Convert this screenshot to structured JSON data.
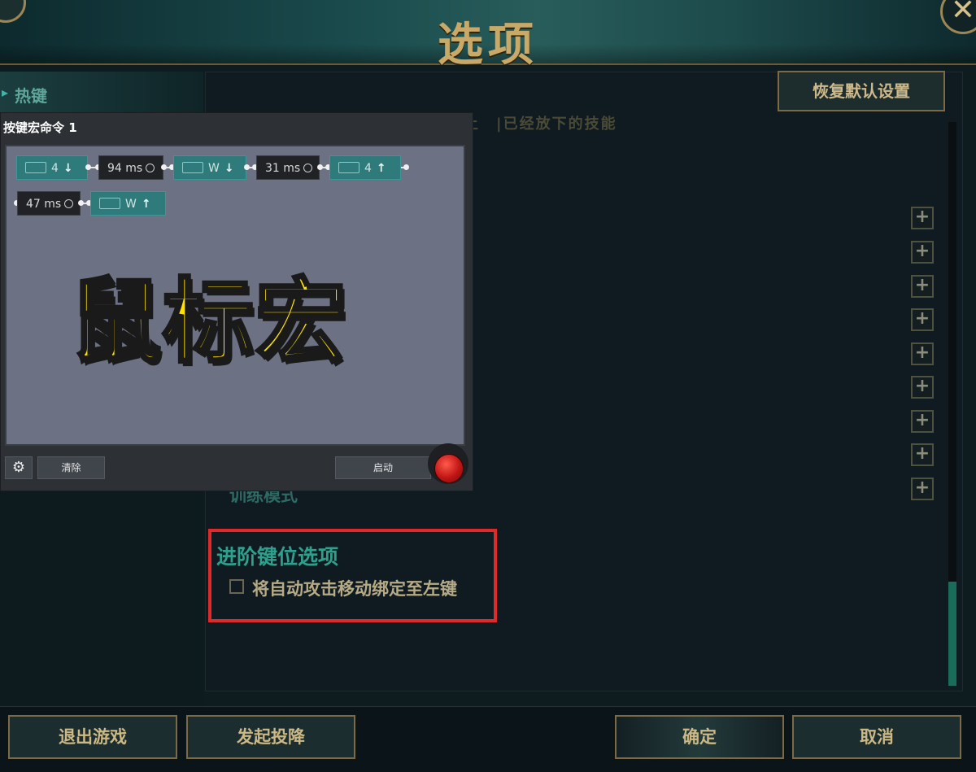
{
  "window": {
    "title": "选项",
    "close_label": "✕"
  },
  "sidebar": {
    "items": [
      {
        "label": "热键",
        "active": true
      }
    ]
  },
  "main": {
    "restore_defaults_label": "恢复默认设置",
    "faded_header_text": "土　|已经放下的技能",
    "training_mode_label": "训练模式",
    "advanced": {
      "title": "进阶键位选项",
      "checkbox_label": "将自动攻击移动绑定至左键",
      "checked": false
    },
    "plus_button_label": "+",
    "plus_button_count": 9
  },
  "bottom": {
    "exit_game_label": "退出游戏",
    "surrender_label": "发起投降",
    "confirm_label": "确定",
    "cancel_label": "取消"
  },
  "macro": {
    "title": "按键宏命令 1",
    "steps": [
      {
        "type": "key",
        "key": "4",
        "direction": "down"
      },
      {
        "type": "delay",
        "label": "94 ms"
      },
      {
        "type": "key",
        "key": "W",
        "direction": "down"
      },
      {
        "type": "delay",
        "label": "31 ms"
      },
      {
        "type": "key",
        "key": "4",
        "direction": "up"
      },
      {
        "type": "delay",
        "label": "47 ms"
      },
      {
        "type": "key",
        "key": "W",
        "direction": "up"
      }
    ],
    "overlay_text": "鼠标宏",
    "clear_label": "清除",
    "start_label": "启动",
    "colors": {
      "overlay_text": "#ffe200",
      "record": "#c01515"
    }
  },
  "colors": {
    "accent_gold": "#c8a968",
    "accent_teal": "#2fa08d",
    "highlight_box": "#e02a2a"
  }
}
